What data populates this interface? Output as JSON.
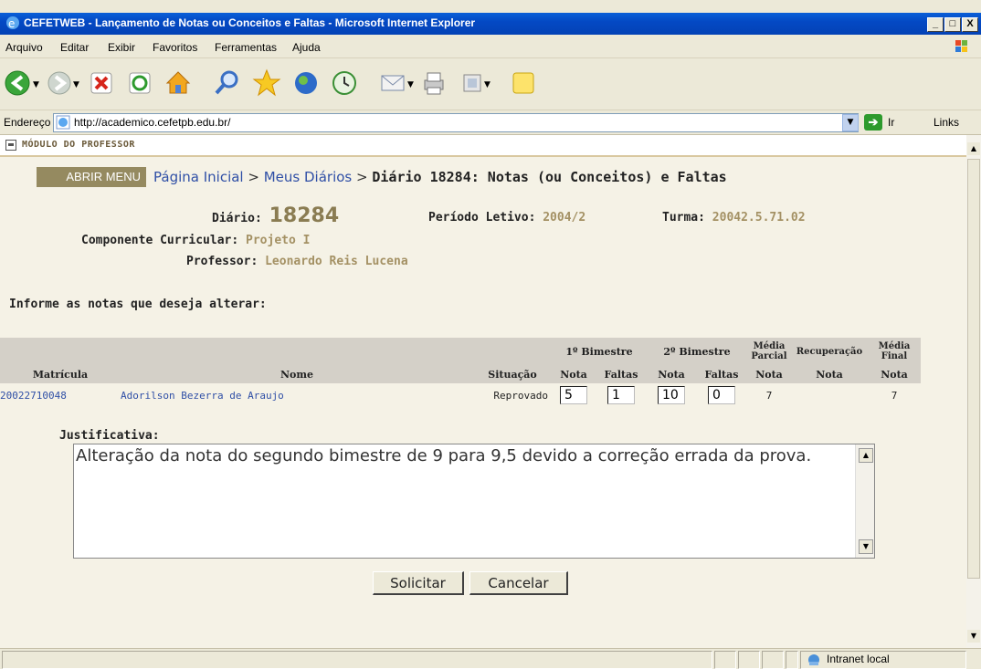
{
  "window": {
    "title": "CEFETWEB - Lançamento de Notas ou Conceitos e Faltas - Microsoft Internet Explorer",
    "minimize": "_",
    "maximize": "□",
    "close": "X"
  },
  "menubar": {
    "items": [
      {
        "label": "Arquivo"
      },
      {
        "label": "Editar"
      },
      {
        "label": "Exibir"
      },
      {
        "label": "Favoritos"
      },
      {
        "label": "Ferramentas"
      },
      {
        "label": "Ajuda"
      }
    ]
  },
  "address": {
    "label": "Endereço",
    "url": "http://academico.cefetpb.edu.br/",
    "go": "Ir",
    "links": "Links"
  },
  "page": {
    "module_title": "MÓDULO DO PROFESSOR",
    "menu_button": "ABRIR MENU",
    "breadcrumb": {
      "home": "Página Inicial",
      "diarios": "Meus Diários",
      "sep": ">",
      "current": "Diário 18284: Notas (ou Conceitos) e Faltas"
    },
    "info": {
      "diario_label": "Diário:",
      "diario_value": "18284",
      "periodo_label": "Período Letivo:",
      "periodo_value": "2004/2",
      "turma_label": "Turma:",
      "turma_value": "20042.5.71.02",
      "componente_label": "Componente Curricular:",
      "componente_value": "Projeto I",
      "professor_label": "Professor:",
      "professor_value": "Leonardo Reis Lucena"
    },
    "prompt": "Informe as notas que deseja alterar:",
    "table": {
      "group_headers": {
        "bim1": "1º Bimestre",
        "bim2": "2º Bimestre",
        "media_parcial": "Média Parcial",
        "recuperacao": "Recuperação",
        "media_final": "Média Final"
      },
      "columns": {
        "matricula": "Matrícula",
        "nome": "Nome",
        "situacao": "Situação",
        "nota": "Nota",
        "faltas": "Faltas"
      },
      "rows": [
        {
          "matricula": "20022710048",
          "nome": "Adorilson Bezerra de Araujo",
          "situacao": "Reprovado",
          "bim1_nota": "5",
          "bim1_faltas": "1",
          "bim2_nota": "10",
          "bim2_faltas": "0",
          "media_parcial": "7",
          "recuperacao": "",
          "media_final": "7"
        }
      ]
    },
    "justificativa": {
      "label": "Justificativa:",
      "text": "Alteração da nota do segundo bimestre de 9 para 9,5 devido a correção errada da prova."
    },
    "buttons": {
      "submit": "Solicitar",
      "cancel": "Cancelar"
    }
  },
  "statusbar": {
    "zone": "Intranet local"
  }
}
